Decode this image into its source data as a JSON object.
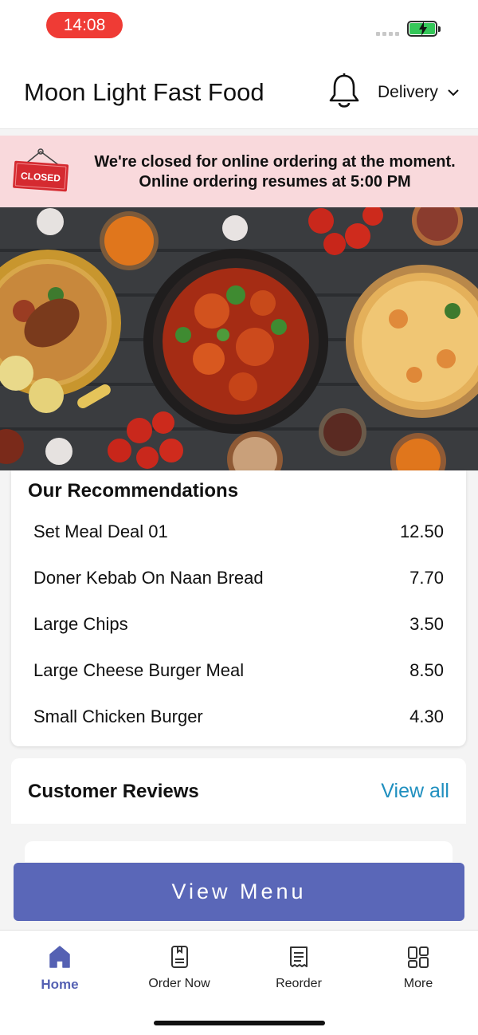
{
  "status_bar": {
    "time": "14:08"
  },
  "header": {
    "store_name": "Moon Light Fast Food",
    "order_mode": "Delivery"
  },
  "closed_banner": {
    "sign_text": "CLOSED",
    "line1": "We're closed for online ordering at the moment.",
    "line2": "Online ordering resumes at 5:00 PM"
  },
  "recommendations": {
    "title": "Our Recommendations",
    "items": [
      {
        "name": "Set Meal Deal 01",
        "price": "12.50"
      },
      {
        "name": "Doner Kebab On Naan Bread",
        "price": "7.70"
      },
      {
        "name": "Large Chips",
        "price": "3.50"
      },
      {
        "name": "Large Cheese Burger Meal",
        "price": "8.50"
      },
      {
        "name": "Small Chicken Burger",
        "price": "4.30"
      }
    ]
  },
  "reviews": {
    "title": "Customer Reviews",
    "view_all": "View all"
  },
  "view_menu_label": "View Menu",
  "bottom_nav": {
    "items": [
      {
        "label": "Home",
        "icon": "home-icon",
        "active": true
      },
      {
        "label": "Order Now",
        "icon": "order-now-icon",
        "active": false
      },
      {
        "label": "Reorder",
        "icon": "receipt-icon",
        "active": false
      },
      {
        "label": "More",
        "icon": "grid-icon",
        "active": false
      }
    ]
  },
  "colors": {
    "accent": "#5a67b8",
    "active_nav": "#5561b3",
    "link": "#1f8fbf",
    "closed_banner_bg": "#f9d9dc",
    "time_pill": "#ef3b35"
  }
}
